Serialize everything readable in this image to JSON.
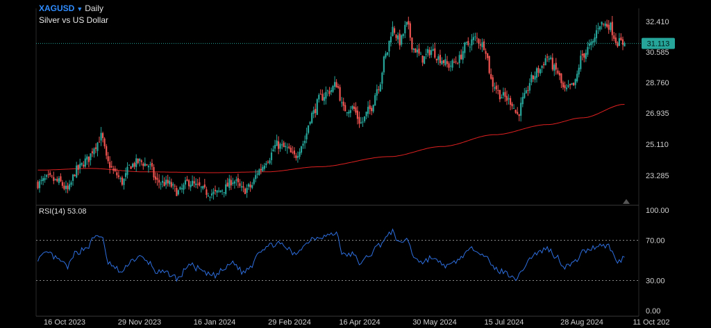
{
  "header": {
    "symbol": "XAGUSD",
    "interval": "Daily",
    "subtitle": "Silver vs US Dollar"
  },
  "rsi": {
    "label": "RSI(14) 53.08"
  },
  "colors": {
    "up": "#26a69a",
    "down": "#ef5350",
    "ma": "#e02020",
    "rsi": "#2e6fe0",
    "price_line": "#26a69a",
    "background": "#000000"
  },
  "chart_data": [
    {
      "type": "candlestick",
      "title": "XAGUSD Daily",
      "subtitle": "Silver vs US Dollar",
      "ylim": [
        21.6,
        33.3
      ],
      "y_ticks": [
        "32.410",
        "30.585",
        "28.760",
        "26.935",
        "25.110",
        "23.285"
      ],
      "x_ticks": [
        "16 Oct 2023",
        "29 Nov 2023",
        "16 Jan 2024",
        "29 Feb 2024",
        "16 Apr 2024",
        "30 May 2024",
        "15 Jul 2024",
        "28 Aug 2024",
        "11 Oct 202"
      ],
      "last_price": "31.113",
      "close_keypoints": [
        [
          0,
          22.8
        ],
        [
          6,
          23.1
        ],
        [
          12,
          22.9
        ],
        [
          17,
          22.4
        ],
        [
          22,
          23.6
        ],
        [
          28,
          24.2
        ],
        [
          33,
          25.1
        ],
        [
          36,
          25.6
        ],
        [
          40,
          24.0
        ],
        [
          44,
          23.4
        ],
        [
          48,
          22.9
        ],
        [
          53,
          23.9
        ],
        [
          58,
          24.1
        ],
        [
          63,
          23.9
        ],
        [
          68,
          22.9
        ],
        [
          74,
          22.8
        ],
        [
          80,
          22.3
        ],
        [
          86,
          22.9
        ],
        [
          91,
          22.6
        ],
        [
          96,
          22.3
        ],
        [
          101,
          22.2
        ],
        [
          106,
          22.5
        ],
        [
          111,
          23.0
        ],
        [
          117,
          22.4
        ],
        [
          121,
          22.6
        ],
        [
          126,
          23.6
        ],
        [
          131,
          24.3
        ],
        [
          136,
          25.1
        ],
        [
          141,
          24.9
        ],
        [
          146,
          24.4
        ],
        [
          151,
          25.2
        ],
        [
          156,
          26.9
        ],
        [
          161,
          27.9
        ],
        [
          166,
          28.3
        ],
        [
          170,
          28.7
        ],
        [
          174,
          27.2
        ],
        [
          179,
          27.3
        ],
        [
          184,
          26.4
        ],
        [
          189,
          27.2
        ],
        [
          194,
          28.6
        ],
        [
          198,
          30.4
        ],
        [
          202,
          32.0
        ],
        [
          206,
          31.2
        ],
        [
          210,
          32.2
        ],
        [
          214,
          30.8
        ],
        [
          219,
          30.2
        ],
        [
          224,
          30.7
        ],
        [
          229,
          30.2
        ],
        [
          234,
          29.8
        ],
        [
          239,
          30.1
        ],
        [
          244,
          31.0
        ],
        [
          249,
          31.4
        ],
        [
          254,
          31.0
        ],
        [
          259,
          28.7
        ],
        [
          264,
          28.0
        ],
        [
          269,
          27.7
        ],
        [
          273,
          26.9
        ],
        [
          277,
          27.9
        ],
        [
          281,
          29.0
        ],
        [
          285,
          29.5
        ],
        [
          290,
          30.3
        ],
        [
          295,
          29.5
        ],
        [
          300,
          28.3
        ],
        [
          305,
          28.6
        ],
        [
          310,
          30.4
        ],
        [
          315,
          31.0
        ],
        [
          320,
          32.3
        ],
        [
          325,
          32.2
        ],
        [
          330,
          31.2
        ],
        [
          334,
          31.1
        ]
      ],
      "ma_keypoints": [
        [
          0,
          23.6
        ],
        [
          30,
          23.7
        ],
        [
          60,
          23.5
        ],
        [
          100,
          23.45
        ],
        [
          130,
          23.5
        ],
        [
          160,
          23.8
        ],
        [
          200,
          24.4
        ],
        [
          230,
          25.0
        ],
        [
          260,
          25.7
        ],
        [
          290,
          26.3
        ],
        [
          310,
          26.7
        ],
        [
          334,
          27.5
        ]
      ]
    },
    {
      "type": "line",
      "title": "RSI(14)",
      "value_label": "53.08",
      "ylim": [
        0,
        100
      ],
      "y_ticks": [
        "100.00",
        "70.00",
        "30.00",
        "0.00"
      ],
      "guide_levels": [
        70,
        30
      ],
      "keypoints": [
        [
          0,
          52
        ],
        [
          6,
          57
        ],
        [
          12,
          50
        ],
        [
          17,
          44
        ],
        [
          22,
          58
        ],
        [
          28,
          63
        ],
        [
          33,
          74
        ],
        [
          36,
          75
        ],
        [
          40,
          48
        ],
        [
          44,
          42
        ],
        [
          48,
          38
        ],
        [
          53,
          50
        ],
        [
          58,
          53
        ],
        [
          63,
          48
        ],
        [
          68,
          38
        ],
        [
          74,
          37
        ],
        [
          80,
          32
        ],
        [
          86,
          46
        ],
        [
          91,
          42
        ],
        [
          96,
          36
        ],
        [
          101,
          35
        ],
        [
          106,
          41
        ],
        [
          111,
          48
        ],
        [
          117,
          38
        ],
        [
          121,
          44
        ],
        [
          126,
          60
        ],
        [
          131,
          64
        ],
        [
          136,
          67
        ],
        [
          141,
          63
        ],
        [
          146,
          56
        ],
        [
          151,
          64
        ],
        [
          156,
          72
        ],
        [
          161,
          74
        ],
        [
          166,
          75
        ],
        [
          170,
          77
        ],
        [
          174,
          55
        ],
        [
          179,
          56
        ],
        [
          184,
          47
        ],
        [
          189,
          56
        ],
        [
          194,
          65
        ],
        [
          198,
          72
        ],
        [
          202,
          79
        ],
        [
          206,
          66
        ],
        [
          210,
          72
        ],
        [
          214,
          54
        ],
        [
          219,
          48
        ],
        [
          224,
          53
        ],
        [
          229,
          47
        ],
        [
          234,
          44
        ],
        [
          239,
          50
        ],
        [
          244,
          58
        ],
        [
          249,
          62
        ],
        [
          254,
          56
        ],
        [
          259,
          43
        ],
        [
          264,
          39
        ],
        [
          269,
          36
        ],
        [
          273,
          32
        ],
        [
          277,
          44
        ],
        [
          281,
          54
        ],
        [
          285,
          58
        ],
        [
          290,
          62
        ],
        [
          295,
          54
        ],
        [
          300,
          44
        ],
        [
          305,
          47
        ],
        [
          310,
          58
        ],
        [
          315,
          62
        ],
        [
          320,
          66
        ],
        [
          325,
          64
        ],
        [
          330,
          48
        ],
        [
          334,
          53
        ]
      ]
    }
  ]
}
